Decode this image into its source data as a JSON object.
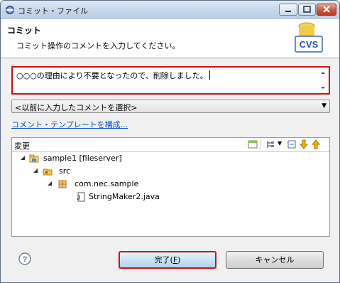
{
  "window": {
    "title": "コミット・ファイル"
  },
  "header": {
    "title": "コミット",
    "description": "コミット操作のコメントを入力してください。",
    "logo_text": "CVS"
  },
  "comment": {
    "value": "○○○の理由により不要となったので、削除しました。"
  },
  "previous_comments": {
    "selected": "<以前に入力したコメントを選択>"
  },
  "template_link": "コメント・テンプレートを構成...",
  "changes": {
    "label": "変更",
    "tree": [
      {
        "label": "sample1  [fileserver]",
        "icon": "project-icon"
      },
      {
        "label": "src",
        "icon": "source-folder-icon"
      },
      {
        "label": "com.nec.sample",
        "icon": "package-icon"
      },
      {
        "label": "StringMaker2.java",
        "icon": "java-file-icon"
      }
    ]
  },
  "buttons": {
    "finish_pre": "完了(",
    "finish_key": "F",
    "finish_post": ")",
    "cancel": "キャンセル"
  },
  "colors": {
    "highlight": "#cc1111",
    "link": "#0b4fc7"
  }
}
